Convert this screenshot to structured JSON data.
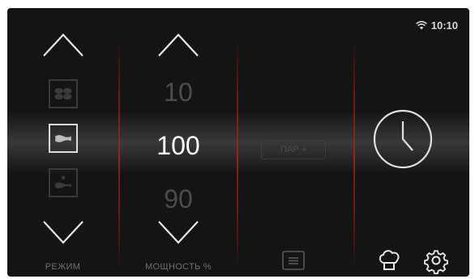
{
  "status": {
    "time": "10:10",
    "wifi_icon": "wifi-icon"
  },
  "mode": {
    "label": "РЕЖИМ",
    "up_icon": "chevron-up-icon",
    "down_icon": "chevron-down-icon",
    "options": [
      {
        "icon": "fan-icon",
        "selected": false
      },
      {
        "icon": "steam-waves-icon",
        "selected": true
      },
      {
        "icon": "steam-low-icon",
        "selected": false
      }
    ]
  },
  "power": {
    "label": "МОЩНОСТЬ %",
    "above": "10",
    "current": "100",
    "below": "90"
  },
  "steam": {
    "label": "ПАР +"
  },
  "timer": {
    "icon": "clock-icon"
  },
  "bottom": {
    "program_icon": "program-list-icon",
    "chef_icon": "chef-hat-icon",
    "settings_icon": "gear-icon"
  },
  "colors": {
    "background": "#141414",
    "divider": "#b01c1c",
    "text_active": "#ffffff",
    "text_dim": "#4c4c4c"
  }
}
